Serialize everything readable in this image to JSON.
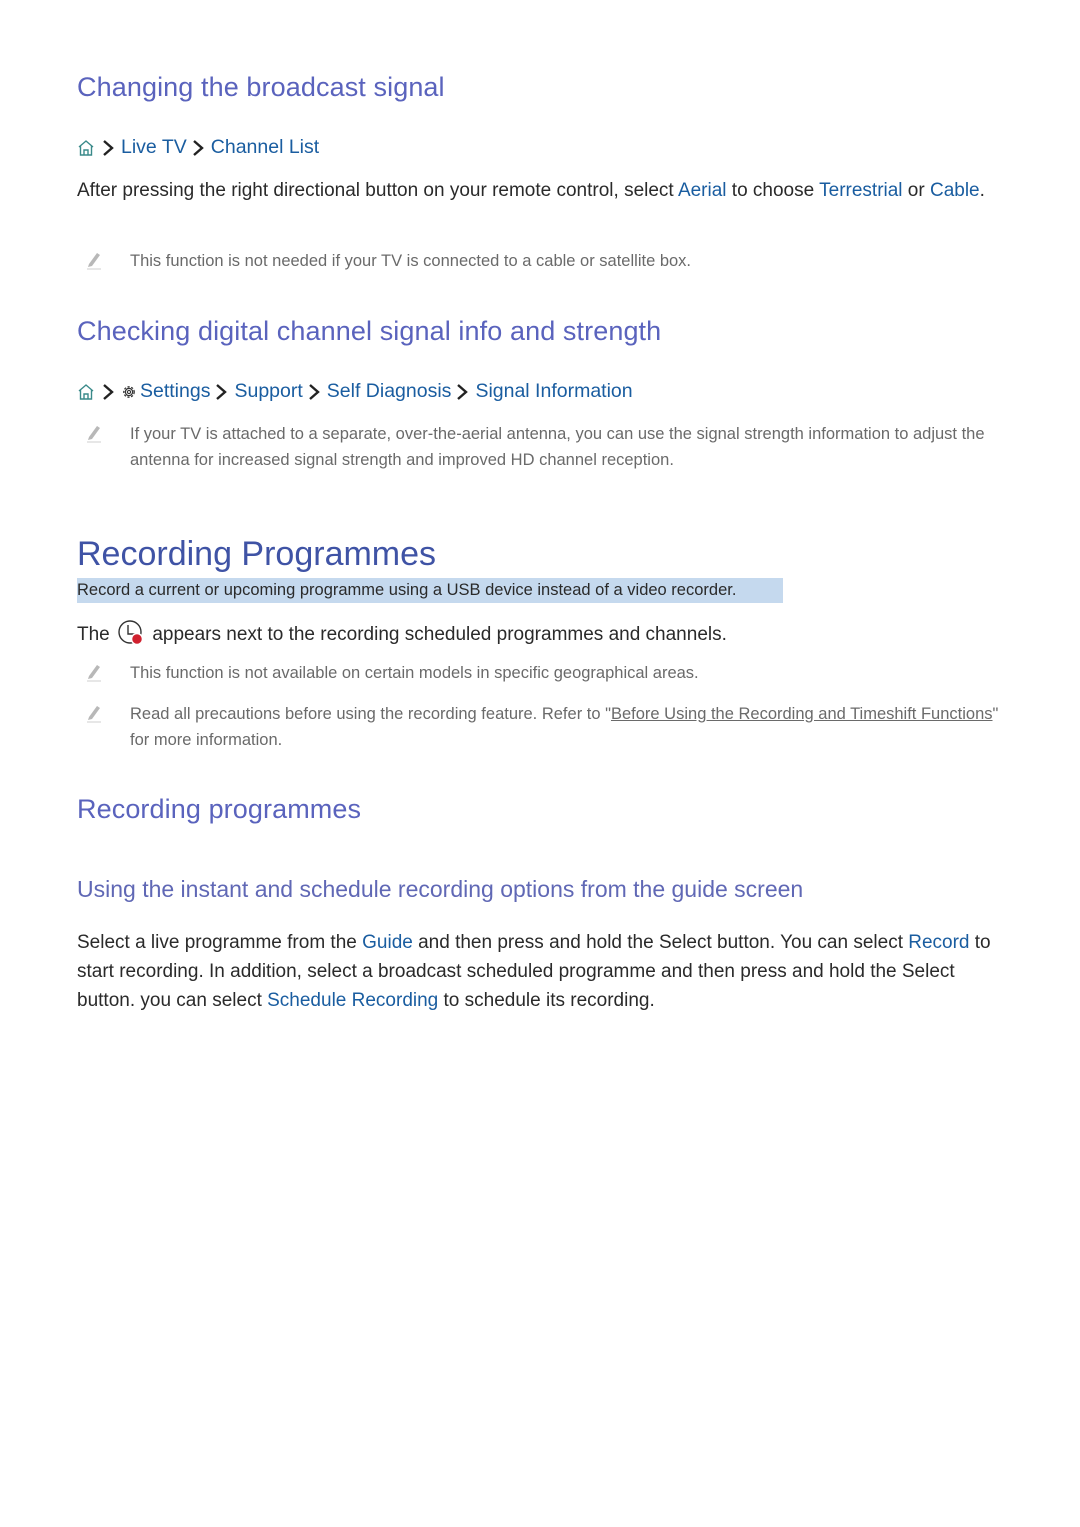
{
  "section1": {
    "heading": "Changing the broadcast signal",
    "breadcrumb": {
      "home_icon": "home-icon",
      "items": [
        "Live TV",
        "Channel List"
      ]
    },
    "body": {
      "part1": "After pressing the right directional button on your remote control, select ",
      "kw1": "Aerial",
      "part2": " to choose ",
      "kw2": "Terrestrial",
      "part3": " or ",
      "kw3": "Cable",
      "part4": "."
    },
    "note": "This function is not needed if your TV is connected to a cable or satellite box."
  },
  "section2": {
    "heading": "Checking digital channel signal info and strength",
    "breadcrumb": {
      "home_icon": "home-icon",
      "settings_icon": "gear-icon",
      "items": [
        "Settings",
        "Support",
        "Self Diagnosis",
        "Signal Information"
      ]
    },
    "note": "If your TV is attached to a separate, over-the-aerial antenna, you can use the signal strength information to adjust the antenna for increased signal strength and improved HD channel reception."
  },
  "section3": {
    "title": "Recording Programmes",
    "summary": "Record a current or upcoming programme using a USB device instead of a video recorder.",
    "icon_line": {
      "before": "The",
      "icon": "recording-scheduled-icon",
      "after": "appears next to the recording scheduled programmes and channels."
    },
    "note1": "This function is not available on certain models in specific geographical areas.",
    "note2": {
      "before": "Read all precautions before using the recording feature. Refer to \"",
      "link": "Before Using the Recording and Timeshift Functions",
      "after": "\" for more information."
    }
  },
  "section4": {
    "heading": "Recording programmes",
    "subheading": "Using the instant and schedule recording options from the guide screen",
    "body": {
      "part1": "Select a live programme from the ",
      "kw1": "Guide",
      "part2": " and then press and hold the Select button. You can select ",
      "kw2": "Record",
      "part3": " to start recording. In addition, select a broadcast scheduled programme and then press and hold the Select button. you can select ",
      "kw3": "Schedule Recording",
      "part4": " to schedule its recording."
    }
  },
  "colors": {
    "heading": "#5a63bd",
    "title": "#3f53a5",
    "keyword": "#1a5da0",
    "highlight": "#c5d9ee",
    "note_text": "#6a6a6a",
    "record_dot": "#d0202e"
  }
}
